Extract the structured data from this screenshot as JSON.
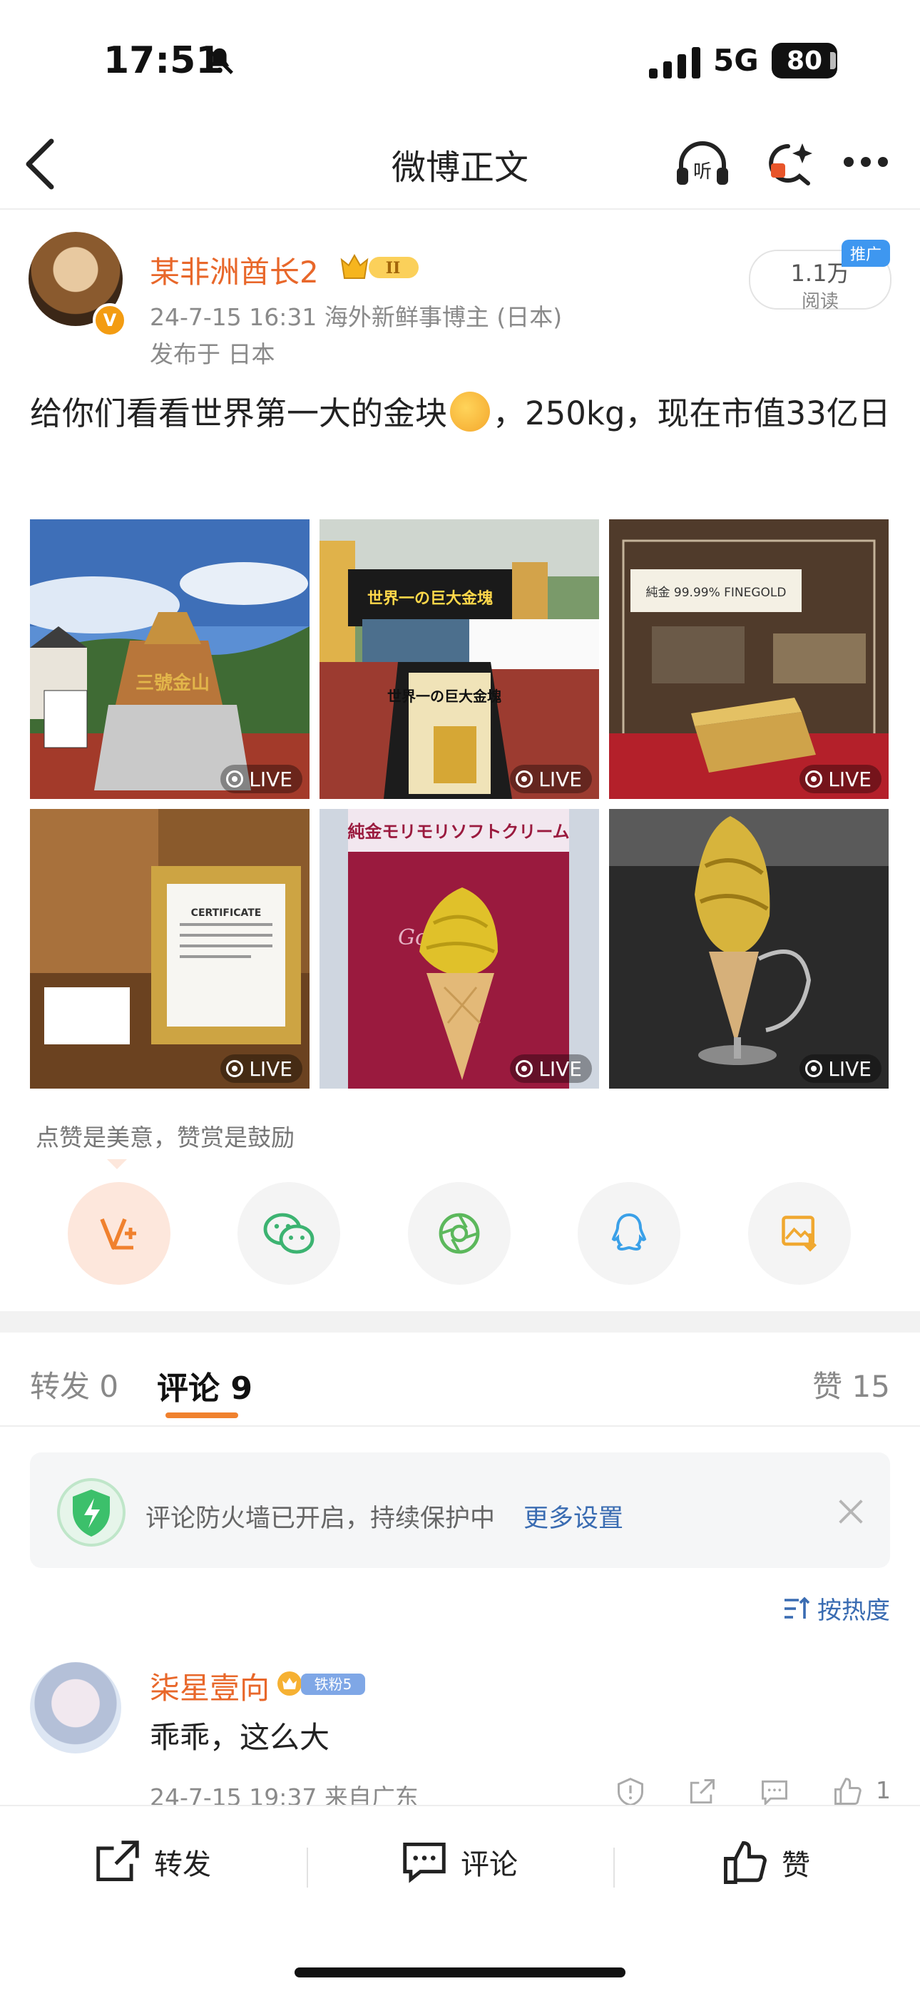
{
  "status_bar": {
    "time": "17:51",
    "network": "5G",
    "battery": "80"
  },
  "nav": {
    "title": "微博正文"
  },
  "post": {
    "author": "某非洲酋长2",
    "level_badge": "II",
    "avatar_badge": "V",
    "meta": "24-7-15 16:31  海外新鲜事博主 (日本)",
    "location": "发布于 日本",
    "reads": "1.1万",
    "reads_label": "阅读",
    "promo_tag": "推广",
    "text_before_emoji": "给你们看看世界第一大的金块",
    "text_after_emoji": "，250kg，现在市值33亿日",
    "live_label": "LIVE",
    "image_texts": {
      "img1": "三號金山",
      "img2_banner": "世界一の巨大金塊",
      "img2_sign": "世界一の巨大金塊",
      "img3_label": "純金 99.99% FINEGOLD",
      "img4_cert": "CERTIFICATE",
      "img5_title": "純金モリモリソフトクリーム",
      "img5_gold": "Gold"
    },
    "likes_note": "点赞是美意，赞赏是鼓励"
  },
  "tabs": {
    "repost_label": "转发",
    "repost_count": "0",
    "comments_label": "评论",
    "comments_count": "9",
    "likes_label": "赞",
    "likes_count": "15"
  },
  "firewall": {
    "text": "评论防火墙已开启，持续保护中",
    "more": "更多设置"
  },
  "sort": {
    "label": "按热度"
  },
  "comments": [
    {
      "name": "柒星壹向",
      "fan_badge": "铁粉5",
      "text": "乖乖，这么大",
      "meta": "24-7-15 19:37  来自广东",
      "likes": "1"
    }
  ],
  "bottom_bar": {
    "repost": "转发",
    "comment": "评论",
    "like": "赞"
  },
  "colors": {
    "accent": "#e8672a",
    "link": "#3a6cb2",
    "tab_underline": "#f0812e"
  }
}
